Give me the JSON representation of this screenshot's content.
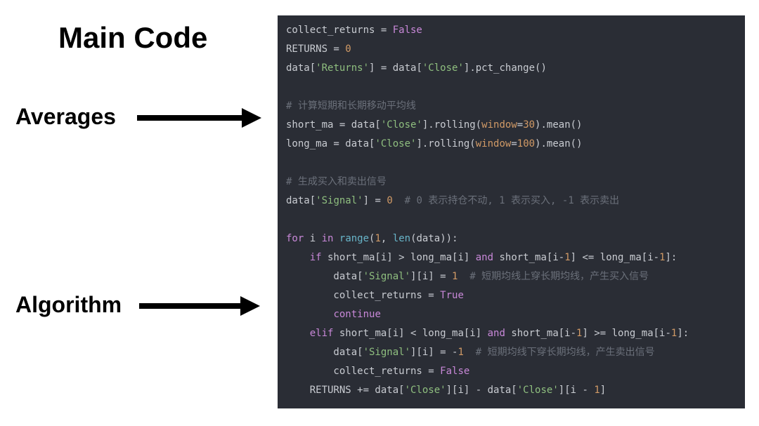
{
  "header": {
    "title": "Main Code"
  },
  "labels": {
    "averages": "Averages",
    "algorithm": "Algorithm"
  },
  "code": {
    "lines": [
      [
        {
          "t": "collect_returns = ",
          "c": "default"
        },
        {
          "t": "False",
          "c": "bool"
        }
      ],
      [
        {
          "t": "RETURNS = ",
          "c": "default"
        },
        {
          "t": "0",
          "c": "number"
        }
      ],
      [
        {
          "t": "data[",
          "c": "default"
        },
        {
          "t": "'Returns'",
          "c": "string"
        },
        {
          "t": "] = data[",
          "c": "default"
        },
        {
          "t": "'Close'",
          "c": "string"
        },
        {
          "t": "].pct_change()",
          "c": "default"
        }
      ],
      [
        {
          "t": "",
          "c": "default"
        }
      ],
      [
        {
          "t": "# 计算短期和长期移动平均线",
          "c": "comment"
        }
      ],
      [
        {
          "t": "short_ma = data[",
          "c": "default"
        },
        {
          "t": "'Close'",
          "c": "string"
        },
        {
          "t": "].rolling(",
          "c": "default"
        },
        {
          "t": "window",
          "c": "param"
        },
        {
          "t": "=",
          "c": "default"
        },
        {
          "t": "30",
          "c": "number"
        },
        {
          "t": ").mean()",
          "c": "default"
        }
      ],
      [
        {
          "t": "long_ma = data[",
          "c": "default"
        },
        {
          "t": "'Close'",
          "c": "string"
        },
        {
          "t": "].rolling(",
          "c": "default"
        },
        {
          "t": "window",
          "c": "param"
        },
        {
          "t": "=",
          "c": "default"
        },
        {
          "t": "100",
          "c": "number"
        },
        {
          "t": ").mean()",
          "c": "default"
        }
      ],
      [
        {
          "t": "",
          "c": "default"
        }
      ],
      [
        {
          "t": "# 生成买入和卖出信号",
          "c": "comment"
        }
      ],
      [
        {
          "t": "data[",
          "c": "default"
        },
        {
          "t": "'Signal'",
          "c": "string"
        },
        {
          "t": "] = ",
          "c": "default"
        },
        {
          "t": "0",
          "c": "number"
        },
        {
          "t": "  ",
          "c": "default"
        },
        {
          "t": "# 0 表示持仓不动, 1 表示买入, -1 表示卖出",
          "c": "comment"
        }
      ],
      [
        {
          "t": "",
          "c": "default"
        }
      ],
      [
        {
          "t": "for",
          "c": "keyword"
        },
        {
          "t": " i ",
          "c": "default"
        },
        {
          "t": "in",
          "c": "keyword"
        },
        {
          "t": " ",
          "c": "default"
        },
        {
          "t": "range",
          "c": "func"
        },
        {
          "t": "(",
          "c": "default"
        },
        {
          "t": "1",
          "c": "number"
        },
        {
          "t": ", ",
          "c": "default"
        },
        {
          "t": "len",
          "c": "func"
        },
        {
          "t": "(data)):",
          "c": "default"
        }
      ],
      [
        {
          "t": "    ",
          "c": "default"
        },
        {
          "t": "if",
          "c": "keyword"
        },
        {
          "t": " short_ma[i] > long_ma[i] ",
          "c": "default"
        },
        {
          "t": "and",
          "c": "keyword"
        },
        {
          "t": " short_ma[i-",
          "c": "default"
        },
        {
          "t": "1",
          "c": "number"
        },
        {
          "t": "] <= long_ma[i-",
          "c": "default"
        },
        {
          "t": "1",
          "c": "number"
        },
        {
          "t": "]:",
          "c": "default"
        }
      ],
      [
        {
          "t": "        data[",
          "c": "default"
        },
        {
          "t": "'Signal'",
          "c": "string"
        },
        {
          "t": "][i] = ",
          "c": "default"
        },
        {
          "t": "1",
          "c": "number"
        },
        {
          "t": "  ",
          "c": "default"
        },
        {
          "t": "# 短期均线上穿长期均线，产生买入信号",
          "c": "comment"
        }
      ],
      [
        {
          "t": "        collect_returns = ",
          "c": "default"
        },
        {
          "t": "True",
          "c": "bool"
        }
      ],
      [
        {
          "t": "        ",
          "c": "default"
        },
        {
          "t": "continue",
          "c": "keyword"
        }
      ],
      [
        {
          "t": "    ",
          "c": "default"
        },
        {
          "t": "elif",
          "c": "keyword"
        },
        {
          "t": " short_ma[i] < long_ma[i] ",
          "c": "default"
        },
        {
          "t": "and",
          "c": "keyword"
        },
        {
          "t": " short_ma[i-",
          "c": "default"
        },
        {
          "t": "1",
          "c": "number"
        },
        {
          "t": "] >= long_ma[i-",
          "c": "default"
        },
        {
          "t": "1",
          "c": "number"
        },
        {
          "t": "]:",
          "c": "default"
        }
      ],
      [
        {
          "t": "        data[",
          "c": "default"
        },
        {
          "t": "'Signal'",
          "c": "string"
        },
        {
          "t": "][i] = -",
          "c": "default"
        },
        {
          "t": "1",
          "c": "number"
        },
        {
          "t": "  ",
          "c": "default"
        },
        {
          "t": "# 短期均线下穿长期均线，产生卖出信号",
          "c": "comment"
        }
      ],
      [
        {
          "t": "        collect_returns = ",
          "c": "default"
        },
        {
          "t": "False",
          "c": "bool"
        }
      ],
      [
        {
          "t": "    RETURNS += data[",
          "c": "default"
        },
        {
          "t": "'Close'",
          "c": "string"
        },
        {
          "t": "][i] - data[",
          "c": "default"
        },
        {
          "t": "'Close'",
          "c": "string"
        },
        {
          "t": "][i - ",
          "c": "default"
        },
        {
          "t": "1",
          "c": "number"
        },
        {
          "t": "]",
          "c": "default"
        }
      ]
    ]
  }
}
